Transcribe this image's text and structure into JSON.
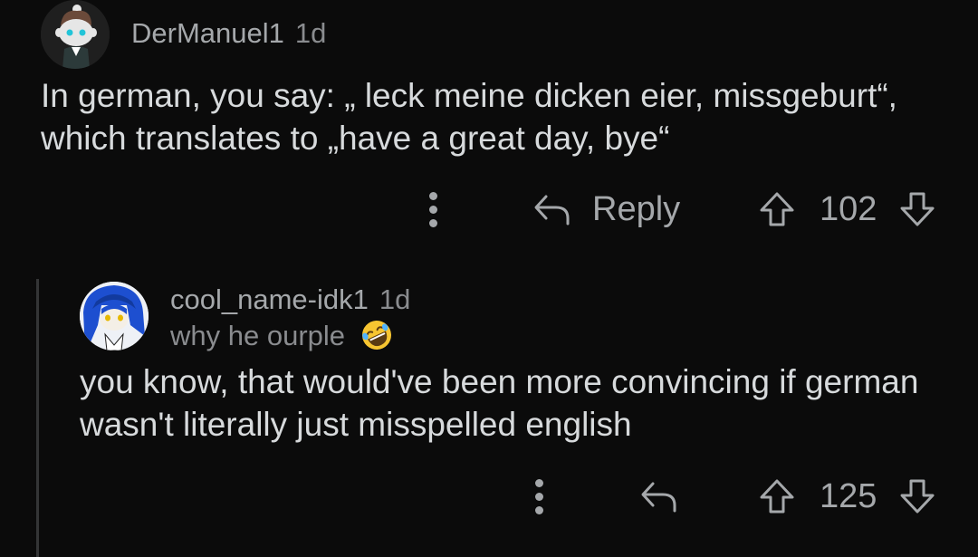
{
  "comments": [
    {
      "username": "DerManuel1",
      "age": "1d",
      "body": "In german, you say: „ leck meine dicken eier, missgeburt“, which translates to „have a great day, bye“",
      "reply_label": "Reply",
      "score": "102",
      "avatar_icon": "snoo-avatar-icon"
    },
    {
      "username": "cool_name-idk1",
      "age": "1d",
      "flair": "why he ourple",
      "flair_emoji": "rolling-on-floor-laughing-emoji",
      "body": "you know, that would've been more convincing if german wasn't literally just misspelled english",
      "score": "125",
      "avatar_icon": "anime-avatar-icon"
    }
  ],
  "colors": {
    "background": "#0b0b0b",
    "text": "#d7dadc",
    "muted": "#a5a8ab",
    "thread_line": "#343536"
  }
}
